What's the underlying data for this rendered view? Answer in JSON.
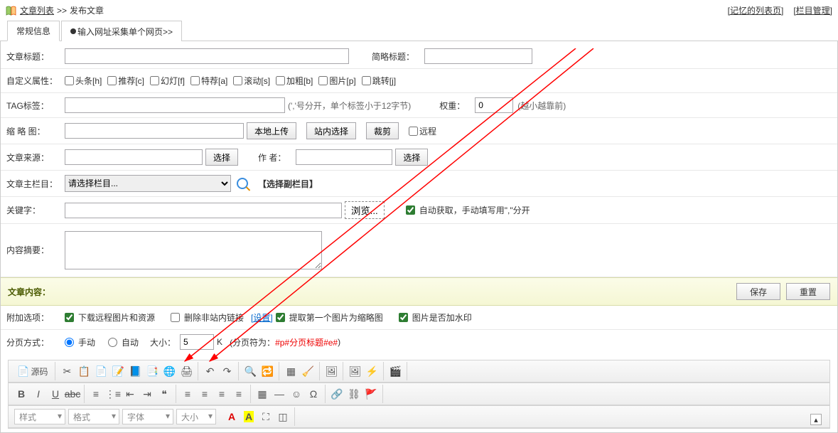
{
  "breadcrumb": {
    "list": "文章列表",
    "sep": ">>",
    "publish": "发布文章"
  },
  "topLinks": {
    "memory": "[记忆的列表页]",
    "column": "[栏目管理]"
  },
  "tabs": {
    "general": "常规信息",
    "collect": "输入网址采集单个网页>>"
  },
  "labels": {
    "title": "文章标题：",
    "shortTitle": "简略标题：",
    "customAttr": "自定义属性：",
    "tag": "TAG标签：",
    "tagHint": "(','号分开，单个标签小于12字节)",
    "weight": "权重：",
    "weightHint": "(越小越靠前)",
    "thumb": "缩 略 图：",
    "localUpload": "本地上传",
    "siteSelect": "站内选择",
    "crop": "裁剪",
    "remote": "远程",
    "source": "文章来源：",
    "select": "选择",
    "author": "作  者：",
    "mainCol": "文章主栏目：",
    "colPlaceholder": "请选择栏目...",
    "subCol": "【选择副栏目】",
    "keywords": "关键字：",
    "browse": "浏览...",
    "autoGet": "自动获取，手动填写用\",\"分开",
    "summary": "内容摘要：",
    "content": "文章内容：",
    "save": "保存",
    "reset": "重置",
    "extra": "附加选项：",
    "downloadRemote": "下载远程图片和资源",
    "delExternal": "删除非站内链接",
    "setting": "[设置]",
    "extractFirst": "提取第一个图片为缩略图",
    "watermark": "图片是否加水印",
    "paging": "分页方式：",
    "manual": "手动",
    "auto_": "自动",
    "size": "大小：",
    "sizeVal": "5",
    "sizeUnit": "K",
    "pagingHint1": "(分页符为：",
    "pagingHint2": "#p#分页标题#e#",
    "pagingHint3": " )",
    "weightVal": "0"
  },
  "attrs": [
    {
      "label": "头条[h]"
    },
    {
      "label": "推荐[c]"
    },
    {
      "label": "幻灯[f]"
    },
    {
      "label": "特荐[a]"
    },
    {
      "label": "滚动[s]"
    },
    {
      "label": "加粗[b]"
    },
    {
      "label": "图片[p]"
    },
    {
      "label": "跳转[j]"
    }
  ],
  "editor": {
    "source": "源码",
    "styles": "样式",
    "format": "格式",
    "font": "字体",
    "fontsize": "大小"
  }
}
